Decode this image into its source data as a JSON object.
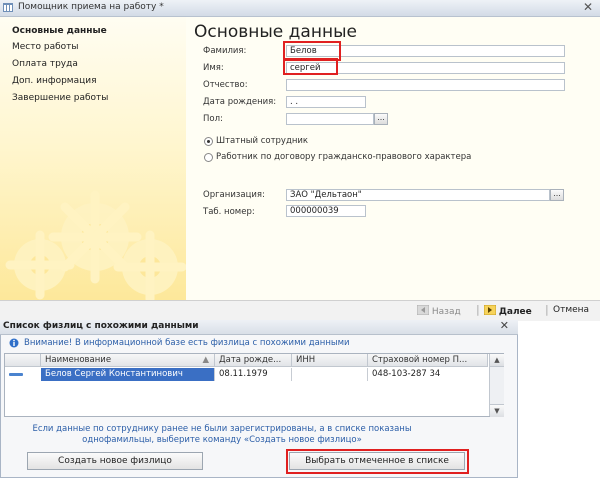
{
  "window": {
    "title": "Помощник приема на работу *",
    "close_glyph": "✕"
  },
  "sidebar": {
    "items": [
      {
        "label": "Основные данные"
      },
      {
        "label": "Место работы"
      },
      {
        "label": "Оплата труда"
      },
      {
        "label": "Доп. информация"
      },
      {
        "label": "Завершение работы"
      }
    ]
  },
  "form": {
    "title": "Основные данные",
    "labels": {
      "lastname": "Фамилия:",
      "firstname": "Имя:",
      "patronymic": "Отчество:",
      "birthdate": "Дата рождения:",
      "gender": "Пол:",
      "org": "Организация:",
      "tabnum": "Таб. номер:"
    },
    "values": {
      "lastname": "Белов",
      "firstname": "сергей",
      "patronymic": "",
      "birthdate": " .  .  ",
      "gender": "",
      "org": "ЗАО \"Дельтаон\"",
      "tabnum": "000000039"
    },
    "pick_glyph": "...",
    "radio_staff": "Штатный сотрудник",
    "radio_contract": "Работник по договору гражданско-правового характера"
  },
  "navigation": {
    "back": "Назад",
    "next": "Далее",
    "cancel": "Отмена"
  },
  "dialog": {
    "title": "Список физлиц с похожими данными",
    "close_glyph": "✕",
    "warning": "Внимание! В информационной базе есть физлица с похожими данными",
    "columns": [
      "Наименование",
      "Дата рожде...",
      "ИНН",
      "Страховой номер П..."
    ],
    "rows": [
      {
        "name": "Белов Сергей Константинович",
        "birthdate": "08.11.1979",
        "inn": "",
        "snils": "048-103-287 34"
      }
    ],
    "hint_line1": "Если данные по сотруднику ранее не были зарегистрированы, а в списке показаны",
    "hint_line2": "однофамильцы, выберите команду «Создать новое физлицо»",
    "create_button": "Создать новое физлицо",
    "select_button": "Выбрать отмеченное в списке"
  },
  "colors": {
    "highlight": "#e02020",
    "selected_row": "#3a6fc4",
    "sidebar_gear": "#fde79a"
  }
}
